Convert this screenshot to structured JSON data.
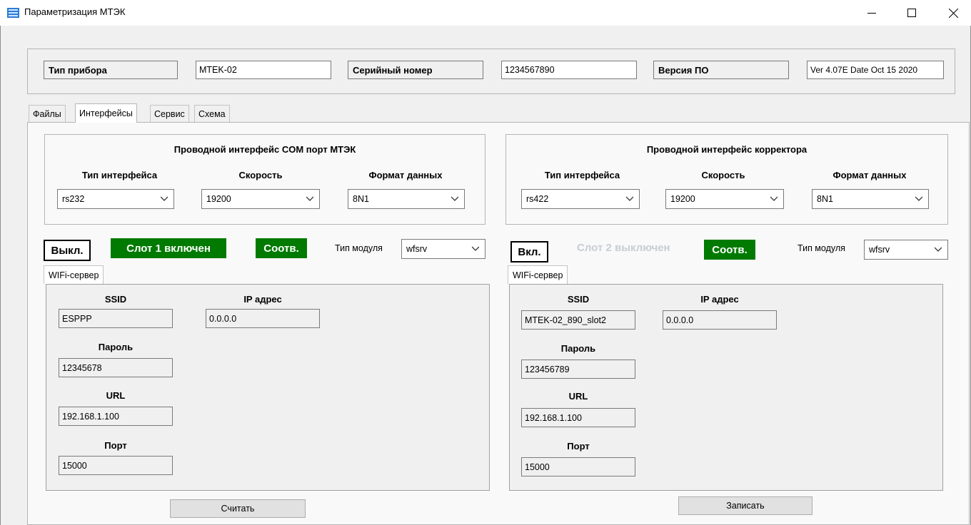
{
  "window": {
    "title": "Параметризация МТЭК",
    "minimize_icon": "minimize-icon",
    "maximize_icon": "maximize-icon",
    "close_icon": "close-icon"
  },
  "device_info": {
    "type_label": "Тип прибора",
    "type_value": "MTEK-02",
    "serial_label": "Серийный номер",
    "serial_value": "1234567890",
    "version_label": "Версия ПО",
    "version_value": "Ver 4.07E Date Oct 15 2020"
  },
  "tabs": [
    {
      "label": "Файлы",
      "active": false
    },
    {
      "label": "Интерфейсы",
      "active": true
    },
    {
      "label": "Сервис",
      "active": false
    },
    {
      "label": "Схема",
      "active": false
    }
  ],
  "left": {
    "group_title": "Проводной интерфейс COM порт МТЭК",
    "iface_type_label": "Тип интерфейса",
    "iface_type_value": "rs232",
    "speed_label": "Скорость",
    "speed_value": "19200",
    "format_label": "Формат данных",
    "format_value": "8N1",
    "toggle_button": "Выкл.",
    "slot_status": "Слот 1 включен",
    "match_status": "Соотв.",
    "module_type_label": "Тип модуля",
    "module_type_value": "wfsrv",
    "sub_tab": "WIFi-сервер",
    "ssid_label": "SSID",
    "ssid_value": "ESPPP",
    "ip_label": "IP адрес",
    "ip_value": "0.0.0.0",
    "password_label": "Пароль",
    "password_value": "12345678",
    "url_label": "URL",
    "url_value": "192.168.1.100",
    "port_label": "Порт",
    "port_value": "15000",
    "action_button": "Считать"
  },
  "right": {
    "group_title": "Проводной интерфейс корректора",
    "iface_type_label": "Тип интерфейса",
    "iface_type_value": "rs422",
    "speed_label": "Скорость",
    "speed_value": "19200",
    "format_label": "Формат данных",
    "format_value": "8N1",
    "toggle_button": "Вкл.",
    "slot_status": "Слот 2 выключен",
    "match_status": "Соотв.",
    "module_type_label": "Тип модуля",
    "module_type_value": "wfsrv",
    "sub_tab": "WIFi-сервер",
    "ssid_label": "SSID",
    "ssid_value": "MTEK-02_890_slot2",
    "ip_label": "IP адрес",
    "ip_value": "0.0.0.0",
    "password_label": "Пароль",
    "password_value": "123456789",
    "url_label": "URL",
    "url_value": "192.168.1.100",
    "port_label": "Порт",
    "port_value": "15000",
    "action_button": "Записать"
  },
  "colors": {
    "status_green": "#007a00",
    "disabled_text": "#c8cdd2"
  }
}
